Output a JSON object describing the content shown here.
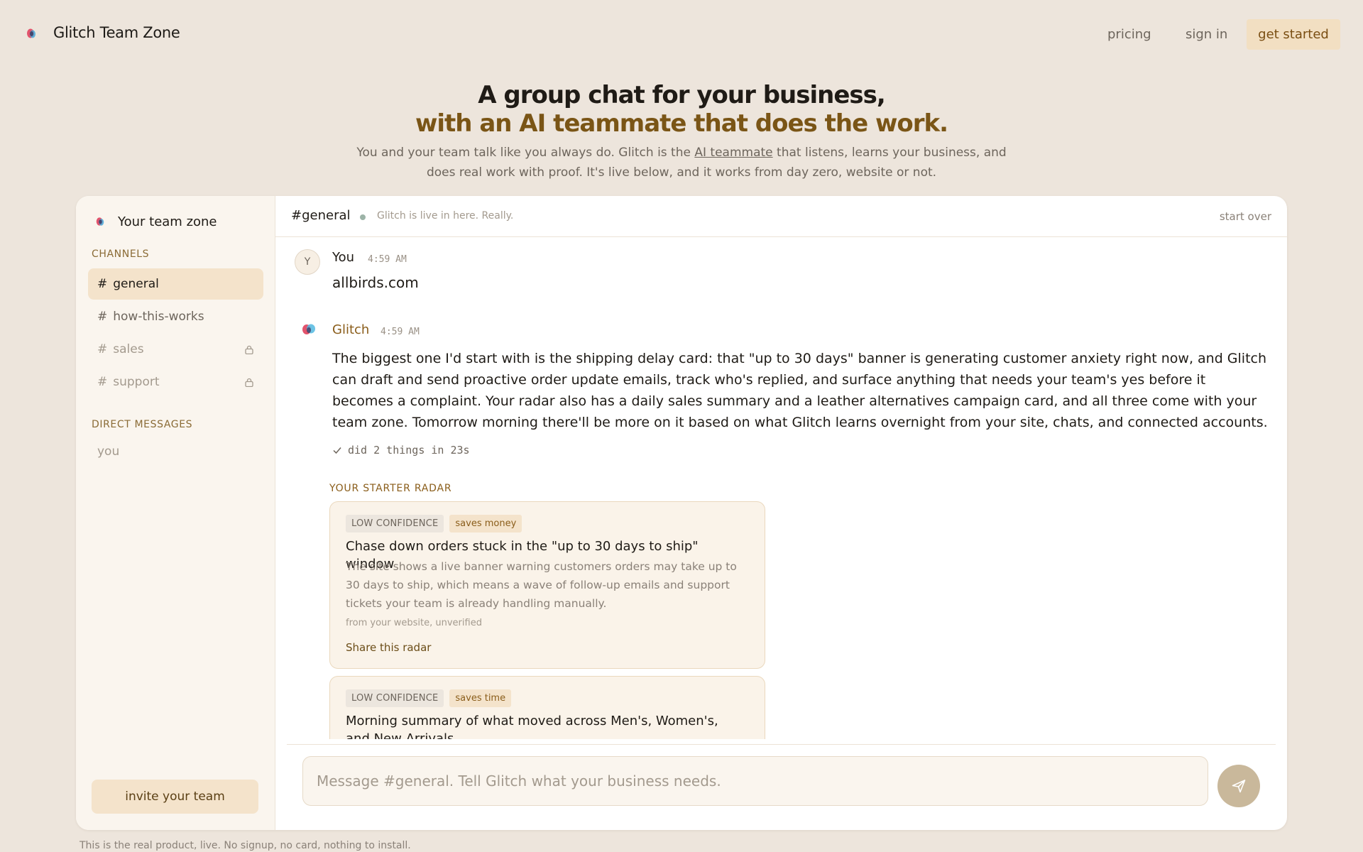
{
  "nav": {
    "brand": "Glitch Team Zone",
    "links": {
      "pricing": "pricing",
      "sign_in": "sign in"
    },
    "cta": "get started"
  },
  "hero": {
    "title_line1": "A group chat for your business,",
    "title_line2": "with an AI teammate that does the work.",
    "sub_before": "You and your team talk like you always do. Glitch is the ",
    "sub_link": "AI teammate",
    "sub_after": " that listens, learns your business, and does real work with proof. It's live below, and it works from day zero, website or not."
  },
  "sidebar": {
    "team_name": "Your team zone",
    "channels_label": "CHANNELS",
    "channels": [
      {
        "hash": "#",
        "label": "general",
        "active": true,
        "locked": false
      },
      {
        "hash": "#",
        "label": "how-this-works",
        "active": false,
        "locked": false
      },
      {
        "hash": "#",
        "label": "sales",
        "active": false,
        "locked": true
      },
      {
        "hash": "#",
        "label": "support",
        "active": false,
        "locked": true
      }
    ],
    "dms_label": "DIRECT MESSAGES",
    "dms": [
      {
        "label": "you"
      }
    ],
    "invite_button": "invite your team"
  },
  "channel": {
    "title": "#general",
    "status": "Glitch is live in here. Really.",
    "start_over": "start over"
  },
  "messages": [
    {
      "avatar": "Y",
      "author": "You",
      "time": "4:59 AM",
      "text": "allbirds.com"
    },
    {
      "avatar_icon": "glitch-logo-icon",
      "author": "Glitch",
      "time": "4:59 AM",
      "text": "The biggest one I'd start with is the shipping delay card: that \"up to 30 days\" banner is generating customer anxiety right now, and Glitch can draft and send proactive order update emails, track who's replied, and surface anything that needs your team's yes before it becomes a complaint. Your radar also has a daily sales summary and a leather alternatives campaign card, and all three come with your team zone. Tomorrow morning there'll be more on it based on what Glitch learns overnight from your site, chats, and connected accounts.",
      "did": "did 2 things in 23s"
    }
  ],
  "radar": {
    "label": "YOUR STARTER RADAR",
    "cards": [
      {
        "confidence": "LOW CONFIDENCE",
        "kind": "saves money",
        "title": "Chase down orders stuck in the \"up to 30 days to ship\" window",
        "description": "The site shows a live banner warning customers orders may take up to 30 days to ship, which means a wave of follow-up emails and support tickets your team is already handling manually.",
        "source": "from your website, unverified",
        "share": "Share this radar"
      },
      {
        "confidence": "LOW CONFIDENCE",
        "kind": "saves time",
        "title": "Morning summary of what moved across Men's, Women's, and New Arrivals"
      }
    ]
  },
  "composer": {
    "placeholder": "Message #general. Tell Glitch what your business needs."
  },
  "footnote": "This is the real product, live. No signup, no card, nothing to install.",
  "colors": {
    "page_bg": "#ede5dc",
    "accent_brown": "#7a5516",
    "cta_bg": "#f2dfc2",
    "active_channel_bg": "#f4e3cb",
    "send_button": "#c9b89b"
  }
}
